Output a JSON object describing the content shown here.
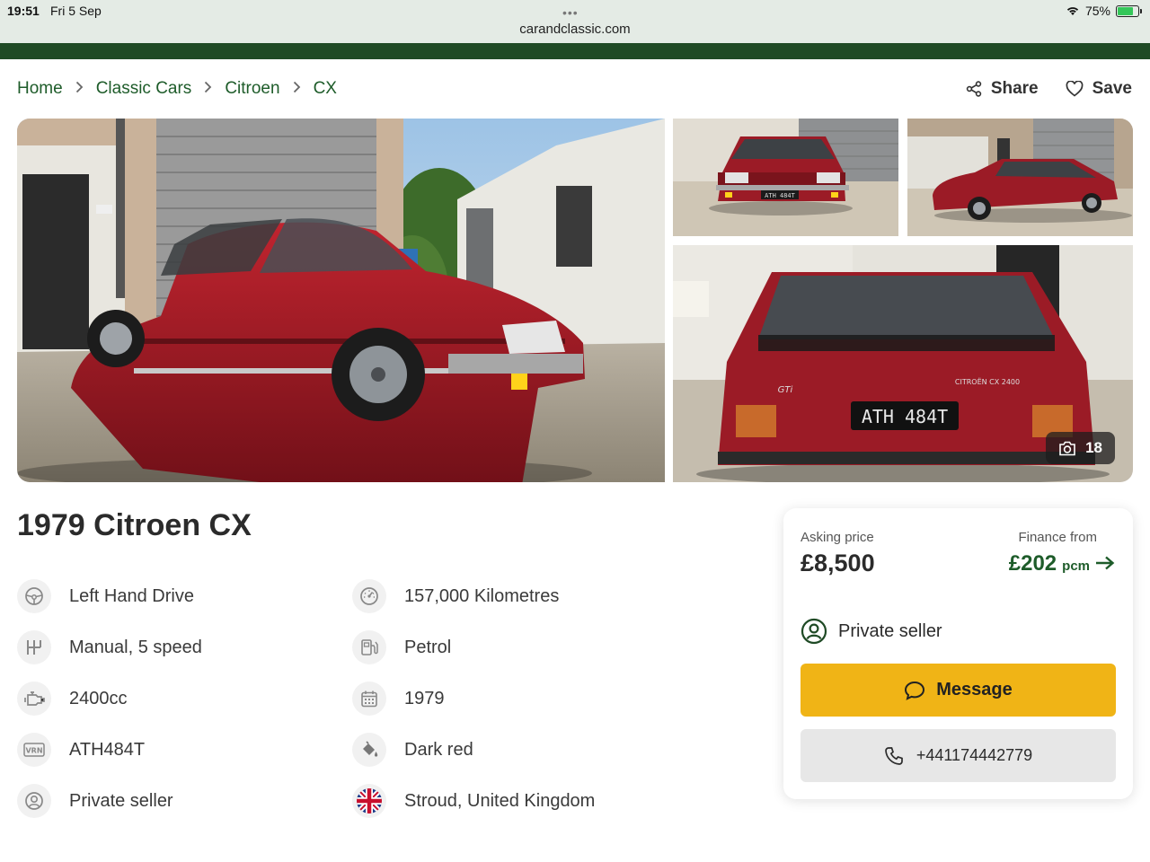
{
  "status": {
    "time": "19:51",
    "date": "Fri 5 Sep",
    "url": "carandclassic.com",
    "battery": "75%",
    "battery_level": 0.75
  },
  "breadcrumb": [
    "Home",
    "Classic Cars",
    "Citroen",
    "CX"
  ],
  "actions": {
    "share": "Share",
    "save": "Save"
  },
  "gallery": {
    "photo_count": "18",
    "plate_text": "ATH 484T",
    "badge_model": "CITROËN CX 2400",
    "badge_trim": "GTi"
  },
  "listing": {
    "title": "1979 Citroen CX"
  },
  "specs": [
    {
      "icon": "steering-wheel-icon",
      "label": "Left Hand Drive"
    },
    {
      "icon": "gearbox-icon",
      "label": "Manual, 5 speed"
    },
    {
      "icon": "engine-icon",
      "label": "2400cc"
    },
    {
      "icon": "registration-vrn-icon",
      "label": "ATH484T"
    },
    {
      "icon": "person-icon",
      "label": "Private seller"
    },
    {
      "icon": "odometer-icon",
      "label": "157,000 Kilometres"
    },
    {
      "icon": "fuel-pump-icon",
      "label": "Petrol"
    },
    {
      "icon": "calendar-icon",
      "label": "1979"
    },
    {
      "icon": "paint-bucket-icon",
      "label": "Dark red"
    },
    {
      "icon": "uk-flag-icon",
      "label": "Stroud, United Kingdom"
    }
  ],
  "price_card": {
    "asking_label": "Asking price",
    "asking_price": "£8,500",
    "finance_label": "Finance from",
    "finance_amount": "£202",
    "finance_unit": "pcm",
    "seller": "Private seller",
    "message_label": "Message",
    "phone": "+441174442779"
  },
  "colors": {
    "brand_green": "#1e5c2a",
    "header_green": "#1f4a25",
    "car_red": "#9b1b26",
    "message_button": "#f0b416"
  }
}
